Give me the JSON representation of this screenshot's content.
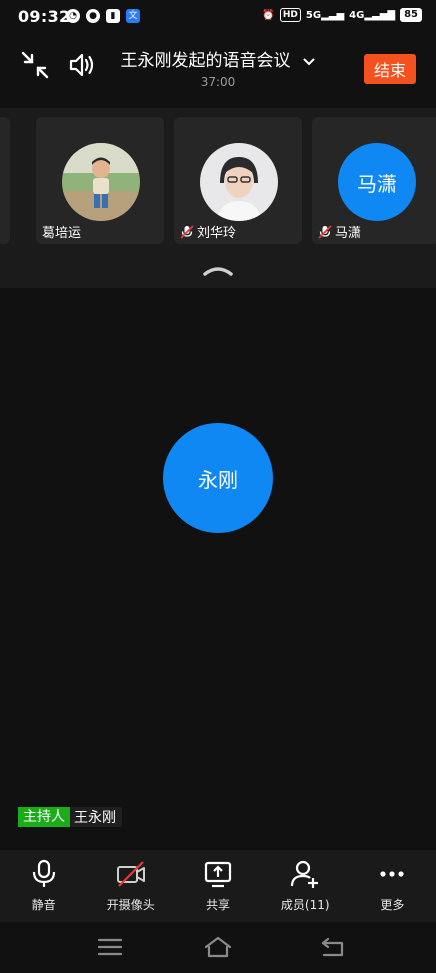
{
  "status_bar": {
    "time": "09:32",
    "icons": [
      "compass-icon",
      "wechat-icon",
      "app-icon",
      "translate-icon"
    ],
    "right_labels": [
      "HD",
      "5G",
      "4G"
    ],
    "battery": "85"
  },
  "header": {
    "title": "王永刚发起的语音会议",
    "timer": "37:00",
    "end_label": "结束"
  },
  "participants": [
    {
      "name": "葛培运",
      "muted": false,
      "avatar": "photo-child"
    },
    {
      "name": "刘华玲",
      "muted": true,
      "avatar": "photo-woman"
    },
    {
      "name": "马潇",
      "muted": true,
      "avatar": "initials",
      "initials": "马潇"
    }
  ],
  "stage": {
    "speaker_initials": "永刚",
    "host_badge": "主持人",
    "host_name": "王永刚"
  },
  "toolbar": {
    "mute_label": "静音",
    "camera_label": "开摄像头",
    "share_label": "共享",
    "members_label": "成员(11)",
    "more_label": "更多"
  },
  "colors": {
    "accent_blue": "#0f88f3",
    "end_button": "#f5511e",
    "host_green": "#1aad19",
    "background": "#111111",
    "camera_off_red": "#e53935"
  }
}
